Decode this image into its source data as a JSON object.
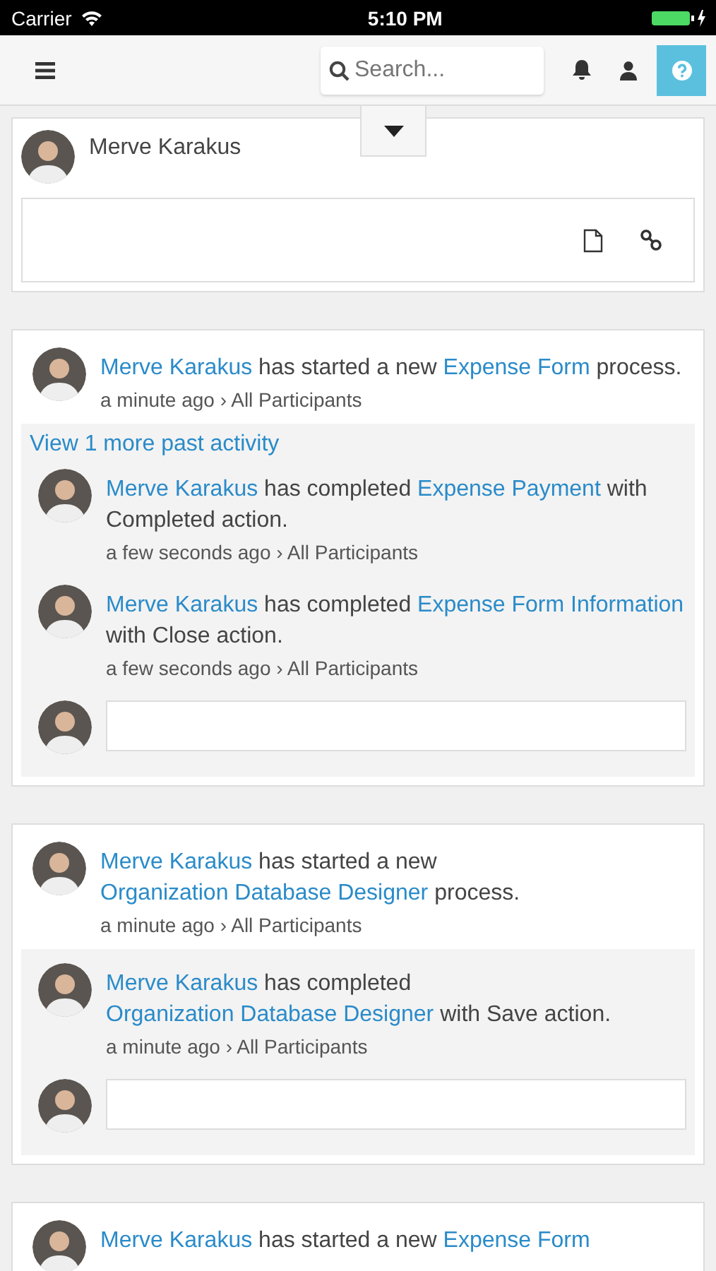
{
  "status_bar": {
    "carrier": "Carrier",
    "time": "5:10 PM"
  },
  "toolbar": {
    "search": {
      "placeholder": "Search..."
    }
  },
  "composer": {
    "author": "Merve Karakus"
  },
  "feed": [
    {
      "segments": [
        {
          "kind": "link",
          "text": "Merve Karakus"
        },
        {
          "kind": "text",
          "text": " has started a new "
        },
        {
          "kind": "link",
          "text": "Expense Form"
        },
        {
          "kind": "text",
          "text": " process."
        }
      ],
      "meta": "a minute ago › All Participants",
      "more_link": "View 1 more past activity",
      "replies": [
        {
          "segments": [
            {
              "kind": "link",
              "text": "Merve Karakus"
            },
            {
              "kind": "text",
              "text": " has completed "
            },
            {
              "kind": "link",
              "text": "Expense Payment"
            },
            {
              "kind": "text",
              "text": " with Completed action."
            }
          ],
          "meta": "a few seconds ago › All Participants"
        },
        {
          "segments": [
            {
              "kind": "link",
              "text": "Merve Karakus"
            },
            {
              "kind": "text",
              "text": " has completed "
            },
            {
              "kind": "link",
              "text": "Expense Form Information"
            },
            {
              "kind": "text",
              "text": " with Close action."
            }
          ],
          "meta": "a few seconds ago › All Participants"
        }
      ]
    },
    {
      "segments": [
        {
          "kind": "link",
          "text": "Merve Karakus"
        },
        {
          "kind": "text",
          "text": " has started a new "
        },
        {
          "kind": "link",
          "text": "Organization Database Designer"
        },
        {
          "kind": "text",
          "text": " process."
        }
      ],
      "meta": "a minute ago › All Participants",
      "replies": [
        {
          "segments": [
            {
              "kind": "link",
              "text": "Merve Karakus"
            },
            {
              "kind": "text",
              "text": " has completed "
            },
            {
              "kind": "link",
              "text": "Organization Database Designer"
            },
            {
              "kind": "text",
              "text": " with Save action."
            }
          ],
          "meta": "a minute ago › All Participants"
        }
      ]
    },
    {
      "segments": [
        {
          "kind": "link",
          "text": "Merve Karakus"
        },
        {
          "kind": "text",
          "text": " has started a new "
        },
        {
          "kind": "link",
          "text": "Expense Form"
        }
      ]
    }
  ]
}
